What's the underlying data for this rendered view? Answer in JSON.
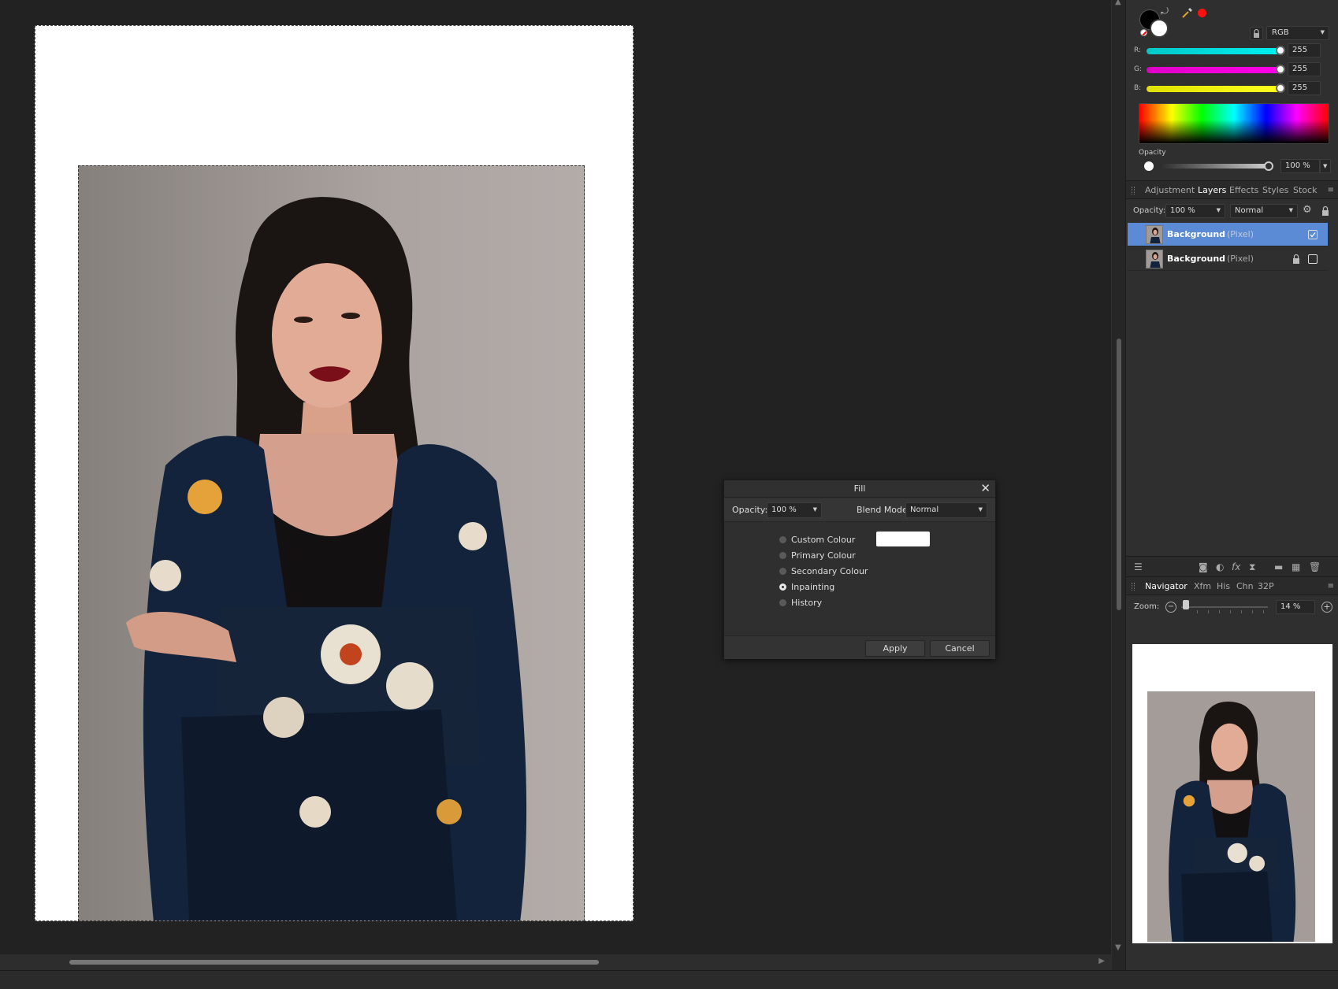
{
  "colour_panel": {
    "mode": "RGB",
    "channels": [
      {
        "label": "R:",
        "value": "255",
        "color": "#00e0e0"
      },
      {
        "label": "G:",
        "value": "255",
        "color": "#f000d8"
      },
      {
        "label": "B:",
        "value": "255",
        "color": "#f0f000"
      }
    ],
    "opacity_label": "Opacity",
    "opacity_value": "100 %"
  },
  "layers_panel": {
    "tabs": [
      "Adjustment",
      "Layers",
      "Effects",
      "Styles",
      "Stock"
    ],
    "active_tab": "Layers",
    "opacity_label": "Opacity:",
    "opacity_value": "100 %",
    "blend_mode": "Normal",
    "layers": [
      {
        "name": "Background",
        "type": "(Pixel)",
        "selected": true,
        "visible": true
      },
      {
        "name": "Background",
        "type": "(Pixel)",
        "selected": false,
        "locked": true,
        "visible": false
      }
    ]
  },
  "navigator_panel": {
    "tabs": [
      "Navigator",
      "Xfm",
      "His",
      "Chn",
      "32P"
    ],
    "active_tab": "Navigator",
    "zoom_label": "Zoom:",
    "zoom_value": "14 %"
  },
  "fill_dialog": {
    "title": "Fill",
    "opacity_label": "Opacity:",
    "opacity_value": "100 %",
    "blend_mode_label": "Blend Mode:",
    "blend_mode_value": "Normal",
    "options": [
      {
        "label": "Custom Colour",
        "selected": false
      },
      {
        "label": "Primary Colour",
        "selected": false
      },
      {
        "label": "Secondary Colour",
        "selected": false
      },
      {
        "label": "Inpainting",
        "selected": true
      },
      {
        "label": "History",
        "selected": false
      }
    ],
    "custom_colour": "#ffffff",
    "apply_label": "Apply",
    "cancel_label": "Cancel"
  },
  "colors": {
    "accent_selection": "#5b8bd4",
    "panel_bg": "#2f2f2f",
    "canvas_bg": "#222222",
    "primary_swatch": "#000000",
    "secondary_swatch": "#ffffff"
  }
}
